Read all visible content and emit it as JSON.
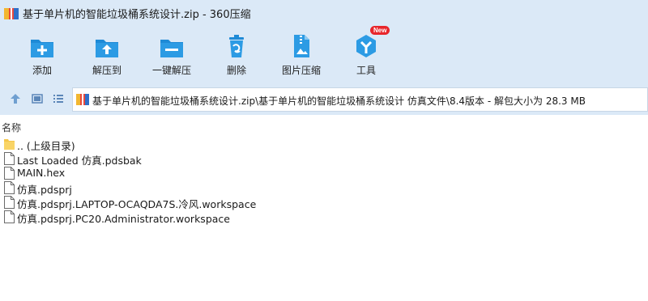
{
  "window": {
    "title": "基于单片机的智能垃圾桶系统设计.zip - 360压缩"
  },
  "toolbar": {
    "items": [
      {
        "label": "添加",
        "icon": "add-icon"
      },
      {
        "label": "解压到",
        "icon": "extract-to-icon"
      },
      {
        "label": "一键解压",
        "icon": "one-click-extract-icon"
      },
      {
        "label": "删除",
        "icon": "delete-icon"
      },
      {
        "label": "图片压缩",
        "icon": "image-compress-icon"
      },
      {
        "label": "工具",
        "icon": "tools-icon",
        "badge": "New"
      }
    ]
  },
  "address": {
    "path": "基于单片机的智能垃圾桶系统设计.zip\\基于单片机的智能垃圾桶系统设计 仿真文件\\8.4版本 - 解包大小为 28.3 MB"
  },
  "list": {
    "column_name": "名称",
    "files": [
      {
        "name": ".. (上级目录)",
        "type": "folder"
      },
      {
        "name": "Last Loaded 仿真.pdsbak",
        "type": "file"
      },
      {
        "name": "MAIN.hex",
        "type": "file"
      },
      {
        "name": "仿真.pdsprj",
        "type": "file"
      },
      {
        "name": "仿真.pdsprj.LAPTOP-OCAQDA7S.冷风.workspace",
        "type": "file"
      },
      {
        "name": "仿真.pdsprj.PC20.Administrator.workspace",
        "type": "file"
      }
    ]
  },
  "colors": {
    "chrome": "#dbe9f7",
    "accent": "#1e8ad6",
    "badge": "#e8262b"
  }
}
